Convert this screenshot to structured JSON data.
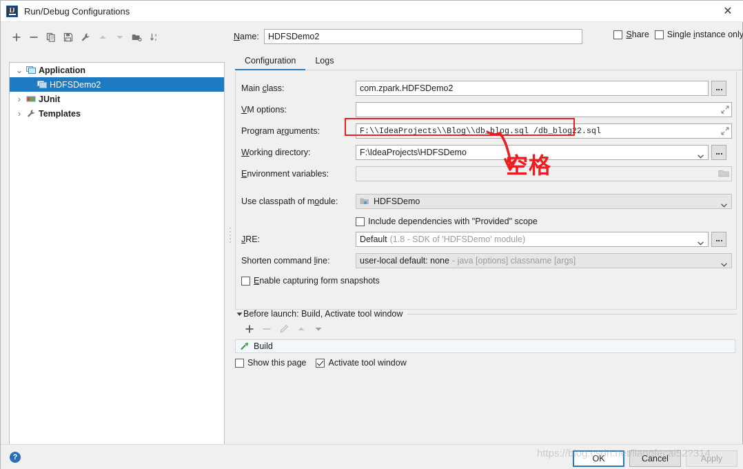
{
  "window": {
    "title": "Run/Debug Configurations",
    "app_icon": "intellij-idea-icon",
    "close_label": "✕"
  },
  "tree_toolbar": {
    "buttons": [
      {
        "name": "add-configuration-button",
        "icon": "plus-icon",
        "enabled": true
      },
      {
        "name": "remove-configuration-button",
        "icon": "minus-icon",
        "enabled": true
      },
      {
        "name": "copy-configuration-button",
        "icon": "copy-icon",
        "enabled": true
      },
      {
        "name": "save-configuration-button",
        "icon": "save-icon",
        "enabled": true
      },
      {
        "name": "edit-templates-button",
        "icon": "wrench-icon",
        "enabled": true
      },
      {
        "name": "move-up-button",
        "icon": "arrow-up-icon",
        "enabled": false
      },
      {
        "name": "move-down-button",
        "icon": "arrow-down-icon",
        "enabled": false
      },
      {
        "name": "new-folder-button",
        "icon": "new-folder-icon",
        "enabled": true
      },
      {
        "name": "sort-alphabetically-button",
        "icon": "sort-az-icon",
        "enabled": true
      }
    ]
  },
  "tree": {
    "items": [
      {
        "label": "Application",
        "icon": "application-icon",
        "twisty": "⌄",
        "level": 0,
        "selected": false
      },
      {
        "label": "HDFSDemo2",
        "icon": "run-config-icon",
        "twisty": "",
        "level": 1,
        "selected": true
      },
      {
        "label": "JUnit",
        "icon": "junit-icon",
        "twisty": "›",
        "level": 0,
        "selected": false
      },
      {
        "label": "Templates",
        "icon": "wrench-icon",
        "twisty": "›",
        "level": 0,
        "selected": false
      }
    ]
  },
  "name_field": {
    "label": "Name:",
    "value": "HDFSDemo2",
    "placeholder": ""
  },
  "top_options": {
    "share": {
      "label": "Share",
      "checked": false
    },
    "single_instance": {
      "label": "Single instance only",
      "checked": false
    }
  },
  "tabs": [
    {
      "label": "Configuration",
      "active": true
    },
    {
      "label": "Logs",
      "active": false
    }
  ],
  "fields": {
    "main_class": {
      "label": "Main class:",
      "value": "com.zpark.HDFSDemo2",
      "browse_icon": "ellipsis-icon"
    },
    "vm_options": {
      "label": "VM options:",
      "value": "",
      "expand_icon": "expand-diagonal-icon"
    },
    "program_arguments": {
      "label": "Program arguments:",
      "value": "F:\\\\IdeaProjects\\\\Blog\\\\db_blog.sql   /db_blog22.sql",
      "expand_icon": "expand-diagonal-icon"
    },
    "working_directory": {
      "label": "Working directory:",
      "value": "F:\\IdeaProjects\\HDFSDemo",
      "dropdown_icon": "chevron-down-icon",
      "browse_icon": "ellipsis-icon"
    },
    "environment_variables": {
      "label": "Environment variables:",
      "value": "",
      "browse_icon": "folder-icon"
    },
    "use_classpath_of_module": {
      "label": "Use classpath of module:",
      "value": "HDFSDemo",
      "item_icon": "module-icon",
      "dropdown_icon": "chevron-down-icon"
    },
    "include_provided": {
      "label": "Include dependencies with \"Provided\" scope",
      "checked": false
    },
    "jre": {
      "label": "JRE:",
      "value": "Default",
      "hint": "(1.8 - SDK of 'HDFSDemo' module)",
      "dropdown_icon": "chevron-down-icon",
      "browse_icon": "ellipsis-icon"
    },
    "shorten_command_line": {
      "label": "Shorten command line:",
      "value": "user-local default: none",
      "hint": "- java [options] classname [args]",
      "dropdown_icon": "chevron-down-icon"
    },
    "enable_form_snapshots": {
      "label": "Enable capturing form snapshots",
      "checked": false
    }
  },
  "before_launch": {
    "title": "Before launch: Build, Activate tool window",
    "collapse_icon": "triangle-down-icon",
    "toolbar": [
      {
        "name": "add-task-button",
        "icon": "plus-icon",
        "enabled": true
      },
      {
        "name": "remove-task-button",
        "icon": "minus-icon",
        "enabled": false
      },
      {
        "name": "edit-task-button",
        "icon": "pencil-icon",
        "enabled": false
      },
      {
        "name": "move-task-up-button",
        "icon": "arrow-up-icon",
        "enabled": false
      },
      {
        "name": "move-task-down-button",
        "icon": "arrow-down-icon",
        "enabled": false
      }
    ],
    "tasks": [
      {
        "label": "Build",
        "icon": "hammer-icon"
      }
    ],
    "show_this_page": {
      "label": "Show this page",
      "checked": false
    },
    "activate_tool_window": {
      "label": "Activate tool window",
      "checked": true
    }
  },
  "footer": {
    "help_icon": "help-icon",
    "help_glyph": "?",
    "buttons": [
      {
        "label": "OK",
        "style": "default"
      },
      {
        "label": "Cancel",
        "style": "normal"
      },
      {
        "label": "Apply",
        "style": "disabled"
      }
    ]
  },
  "annotation": {
    "note_text": "空格",
    "highlight_color": "#ee1c21"
  },
  "watermark": {
    "text": "https://blog.csdn.net/liangfecai52?314"
  }
}
